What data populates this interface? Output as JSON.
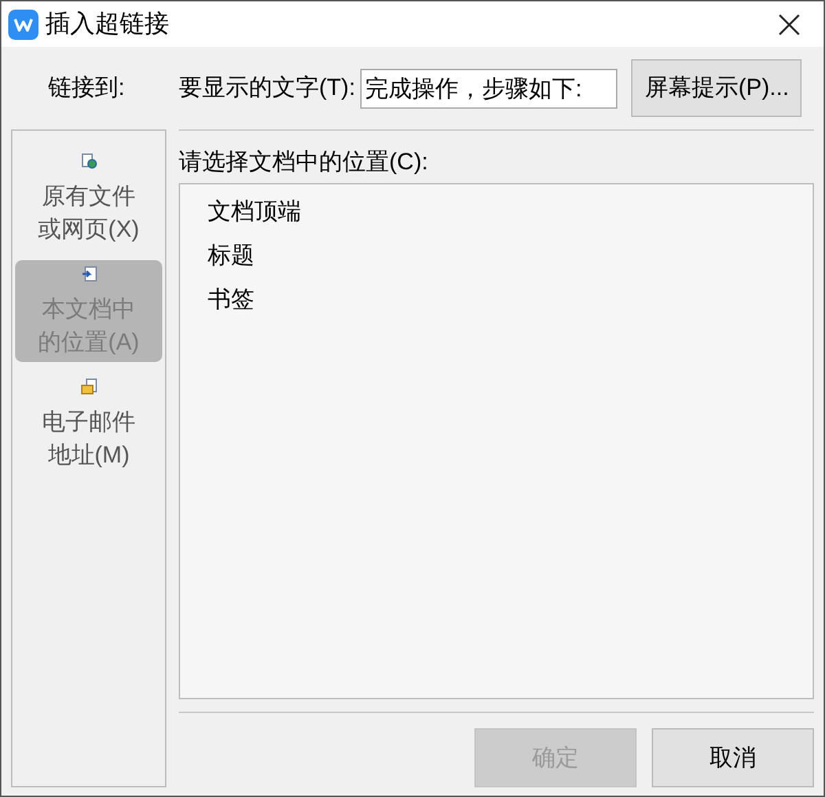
{
  "window": {
    "title": "插入超链接"
  },
  "link_to_label": "链接到:",
  "display_text": {
    "label": "要显示的文字(T):",
    "value": "完成操作，步骤如下:"
  },
  "screen_tip_button": "屏幕提示(P)...",
  "sidebar": {
    "items": [
      {
        "kind": "file",
        "label": "原有文件或网页(X)",
        "selected": false
      },
      {
        "kind": "document",
        "label": "本文档中的位置(A)",
        "selected": true
      },
      {
        "kind": "email",
        "label": "电子邮件地址(M)",
        "selected": false
      }
    ]
  },
  "location": {
    "label": "请选择文档中的位置(C):",
    "items": [
      "文档顶端",
      "标题",
      "书签"
    ]
  },
  "buttons": [
    {
      "label": "确定",
      "disabled": true
    },
    {
      "label": "取消",
      "disabled": false
    }
  ]
}
